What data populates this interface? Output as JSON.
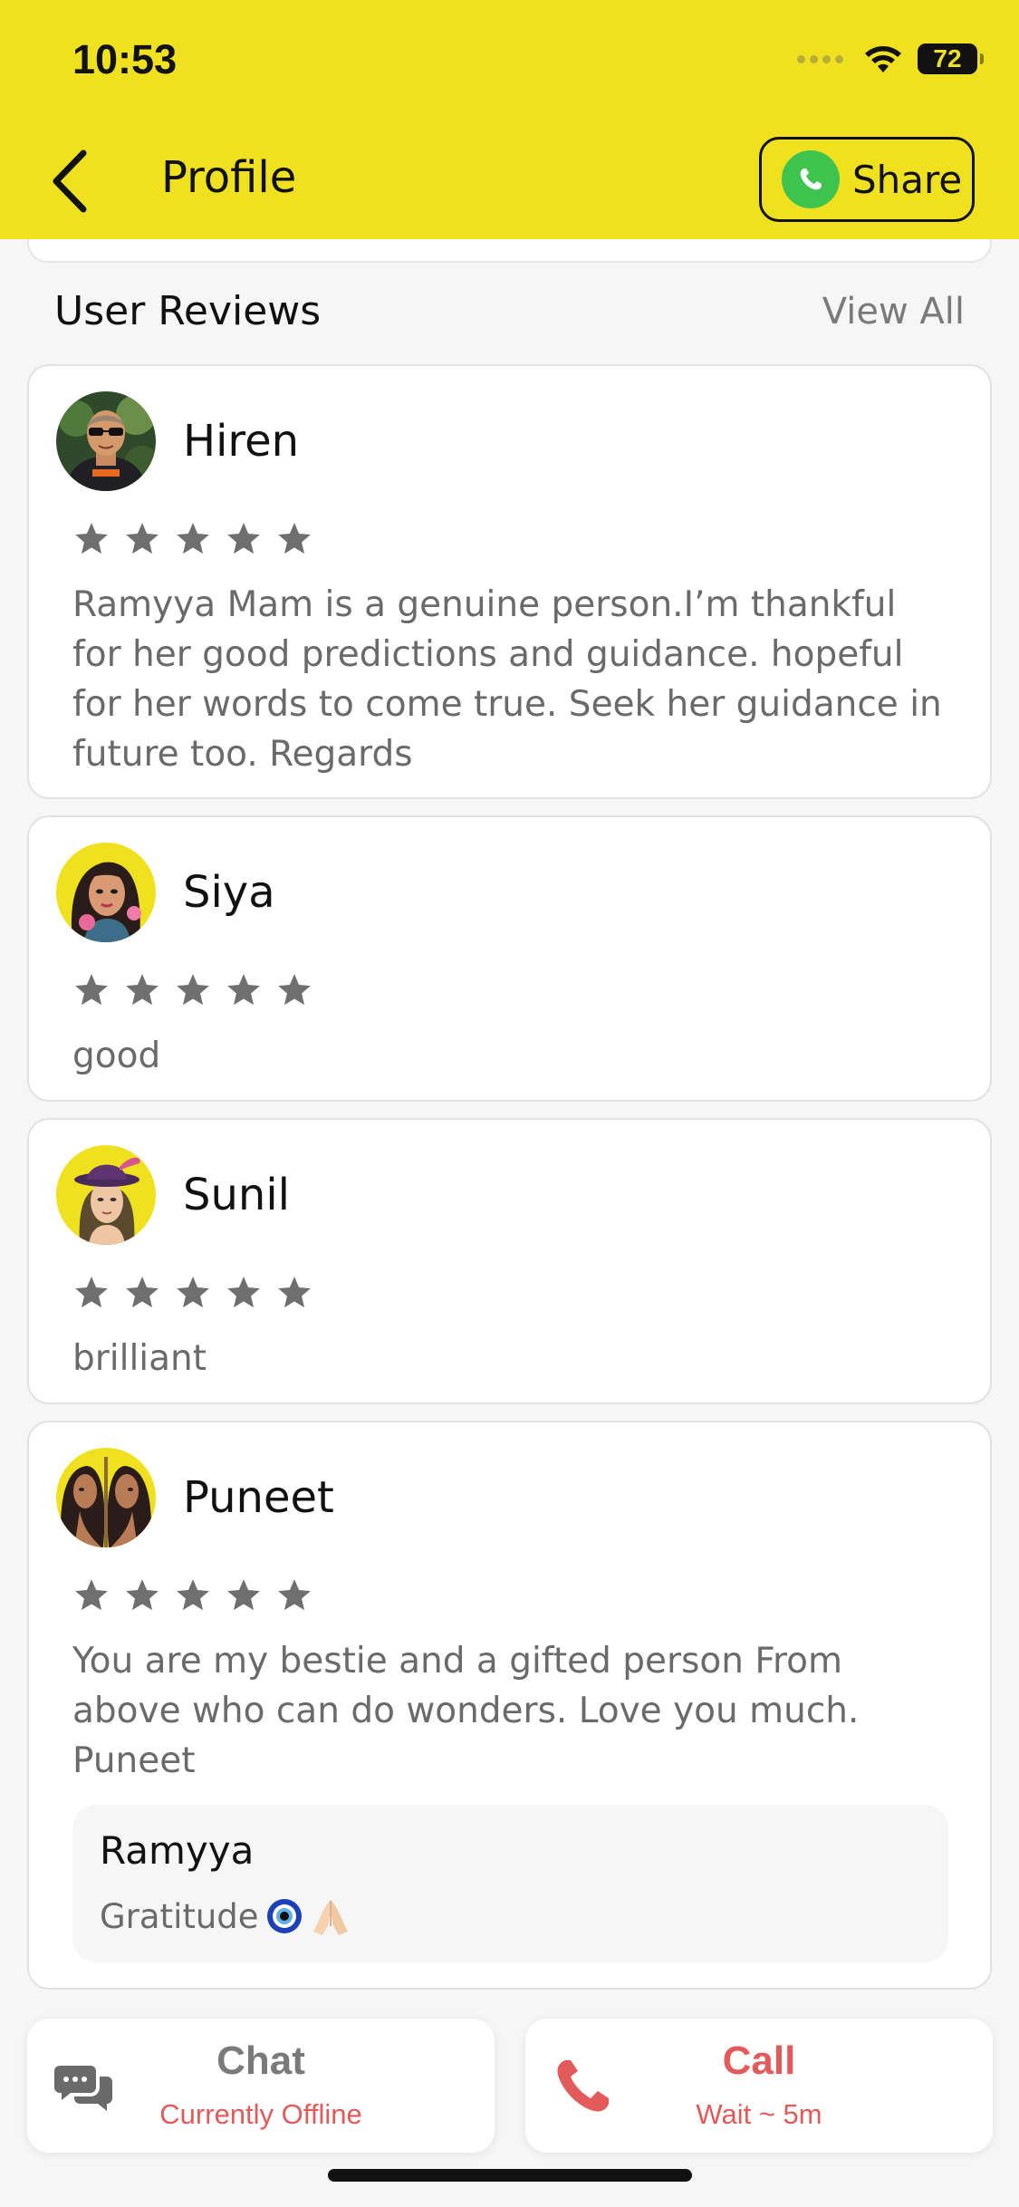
{
  "status_bar": {
    "time": "10:53",
    "battery": "72"
  },
  "header": {
    "title": "Profile",
    "share_label": "Share"
  },
  "reviews_section": {
    "title": "User Reviews",
    "view_all": "View All"
  },
  "reviews": [
    {
      "name": "Hiren",
      "rating": 5,
      "text": "Ramyya Mam is a genuine person.I’m thankful for her good predictions and guidance. hopeful for her words to come true. Seek her guidance in future too. Regards"
    },
    {
      "name": "Siya",
      "rating": 5,
      "text": "good"
    },
    {
      "name": "Sunil",
      "rating": 5,
      "text": "brilliant"
    },
    {
      "name": "Puneet",
      "rating": 5,
      "text": "You are my bestie and a gifted person From above who can do wonders. Love you much. Puneet",
      "reply": {
        "name": "Ramyya",
        "text": "Gratitude"
      }
    }
  ],
  "actions": {
    "chat": {
      "label": "Chat",
      "status": "Currently Offline"
    },
    "call": {
      "label": "Call",
      "status": "Wait ~ 5m"
    }
  },
  "colors": {
    "brand_yellow": "#f0e120",
    "accent_red": "#e25a5a",
    "star_gray": "#6f6f6f"
  }
}
